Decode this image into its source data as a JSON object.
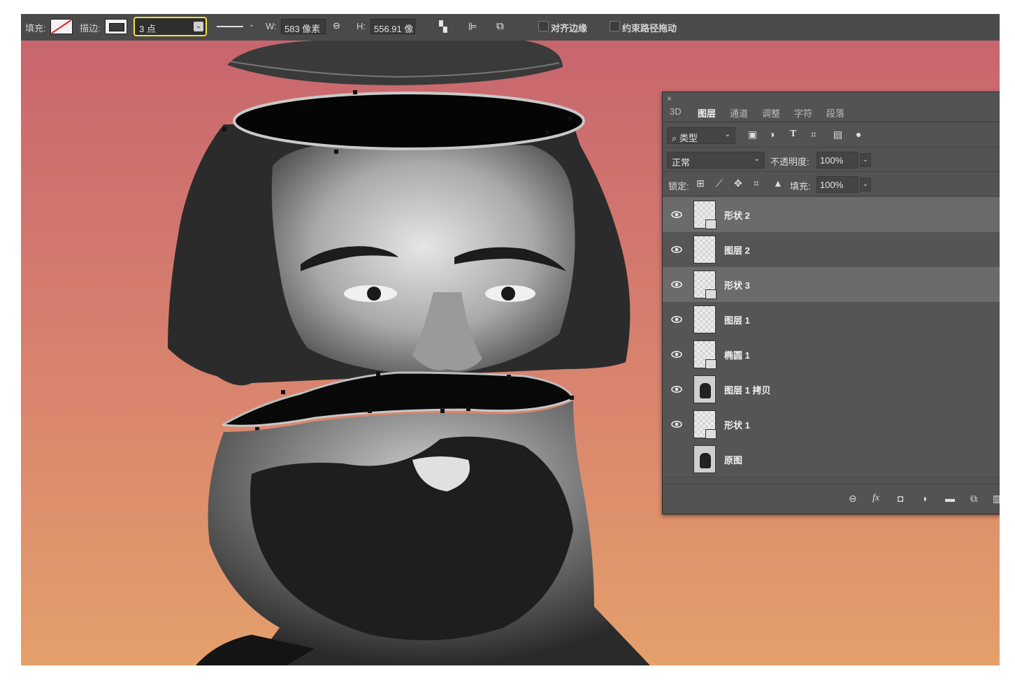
{
  "options_bar": {
    "fill_label": "填充:",
    "stroke_label": "描边:",
    "stroke_size": "3 点",
    "width_label": "W:",
    "width_value": "583 像素",
    "height_label": "H:",
    "height_value": "556.91 像",
    "align_edges_label": "对齐边缘",
    "constrain_path_label": "约束路径拖动"
  },
  "layers_panel": {
    "close_glyph": "×",
    "tabs": [
      "3D",
      "图层",
      "通道",
      "调整",
      "字符",
      "段落"
    ],
    "active_tab": "图层",
    "filter": {
      "search_glyph": "⌕",
      "kind_label": "类型"
    },
    "blend_mode": "正常",
    "opacity_label": "不透明度:",
    "opacity_value": "100%",
    "lock_label": "锁定:",
    "fill_label": "填充:",
    "fill_value": "100%",
    "layers": [
      {
        "name": "形状 2",
        "visible": true,
        "selected": true,
        "kind": "shape"
      },
      {
        "name": "图层 2",
        "visible": true,
        "selected": false,
        "kind": "pixel"
      },
      {
        "name": "形状 3",
        "visible": true,
        "selected": true,
        "kind": "shape"
      },
      {
        "name": "图层 1",
        "visible": true,
        "selected": false,
        "kind": "pixel"
      },
      {
        "name": "椭圆 1",
        "visible": true,
        "selected": false,
        "kind": "shape"
      },
      {
        "name": "图层 1 拷贝",
        "visible": true,
        "selected": false,
        "kind": "photo"
      },
      {
        "name": "形状 1",
        "visible": true,
        "selected": false,
        "kind": "shape"
      },
      {
        "name": "原图",
        "visible": false,
        "selected": false,
        "kind": "photo"
      }
    ]
  },
  "colors": {
    "panel_bg": "#535353",
    "toolbar_bg": "#4a4a4a",
    "highlight_yellow": "#f0e23a",
    "canvas_top": "#c7666e",
    "canvas_bottom": "#e4a06b"
  }
}
